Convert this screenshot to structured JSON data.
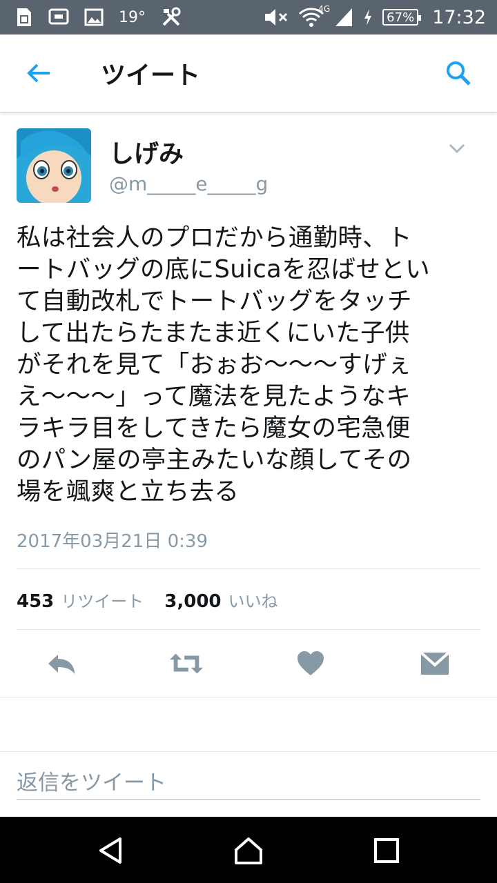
{
  "status_bar": {
    "temperature": "19°",
    "network": "4G",
    "battery": "67%",
    "time": "17:32",
    "icons": [
      "sim-card-icon",
      "cast-icon",
      "image-icon",
      "tools-icon",
      "mute-icon",
      "wifi-icon",
      "signal-icon",
      "charging-icon"
    ]
  },
  "header": {
    "title": "ツイート",
    "back_icon": "back-arrow-icon",
    "search_icon": "search-icon"
  },
  "tweet": {
    "display_name": "しげみ",
    "handle": "@m_____e_____g",
    "text": "私は社会人のプロだから通勤時、ト\nートバッグの底にSuicaを忍ばせとい\nて自動改札でトートバッグをタッチ\nして出たらたまたま近くにいた子供\nがそれを見て「おぉお〜〜〜すげぇ\nえ〜〜〜」って魔法を見たようなキ\nラキラ目をしてきたら魔女の宅急便\nのパン屋の亭主みたいな顔してその\n場を颯爽と立ち去る",
    "timestamp": "2017年03月21日 0:39",
    "retweets_count": "453",
    "retweets_label": "リツイート",
    "likes_count": "3,000",
    "likes_label": "いいね"
  },
  "actions": [
    "reply-icon",
    "retweet-icon",
    "heart-icon",
    "message-icon"
  ],
  "reply": {
    "placeholder": "返信をツイート"
  },
  "colors": {
    "accent": "#1da1f2",
    "status_bar": "#59646e",
    "secondary_text": "#8899a6",
    "action_icon": "#8899a6"
  }
}
